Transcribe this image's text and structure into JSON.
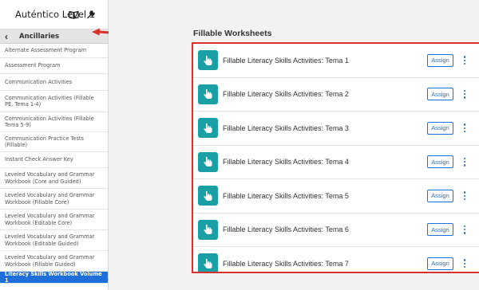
{
  "sidebar": {
    "title": "Auténtico Level 1",
    "back_label": "Ancillaries",
    "icons": [
      "book-icon",
      "wrench-icon"
    ],
    "items": [
      "Alternate Assessment Program",
      "Assessment Program",
      "Communication Activities",
      "Communication Activities (Fillable PE, Tema 1-4)",
      "Communication Activities (Fillable Tema 5-9)",
      "Communication Practice Tests (Fillable)",
      "Instant Check Answer Key",
      "Leveled Vocabulary and Grammar Workbook (Core and Guided)",
      "Leveled Vocabulary and Grammar Workbook (Fillable Core)",
      "Leveled Vocabulary and Grammar Workbook (Editable Core)",
      "Leveled Vocabulary and Grammar Workbook (Editable Guided)",
      "Leveled Vocabulary and Grammar Workbook (Fillable Guided)",
      "Literacy Skills Workbook Volume 1"
    ],
    "active_index": 12
  },
  "main": {
    "section_title": "Fillable Worksheets",
    "assign_label": "Assign",
    "rows": [
      "Fillable Literacy Skills Activities: Tema 1",
      "Fillable Literacy Skills Activities: Tema 2",
      "Fillable Literacy Skills Activities: Tema 3",
      "Fillable Literacy Skills Activities: Tema 4",
      "Fillable Literacy Skills Activities: Tema 5",
      "Fillable Literacy Skills Activities: Tema 6",
      "Fillable Literacy Skills Activities: Tema 7"
    ]
  },
  "colors": {
    "accent_blue": "#1e6fd9",
    "teal_icon": "#1aa0a4",
    "highlight_red": "#d9302c"
  }
}
